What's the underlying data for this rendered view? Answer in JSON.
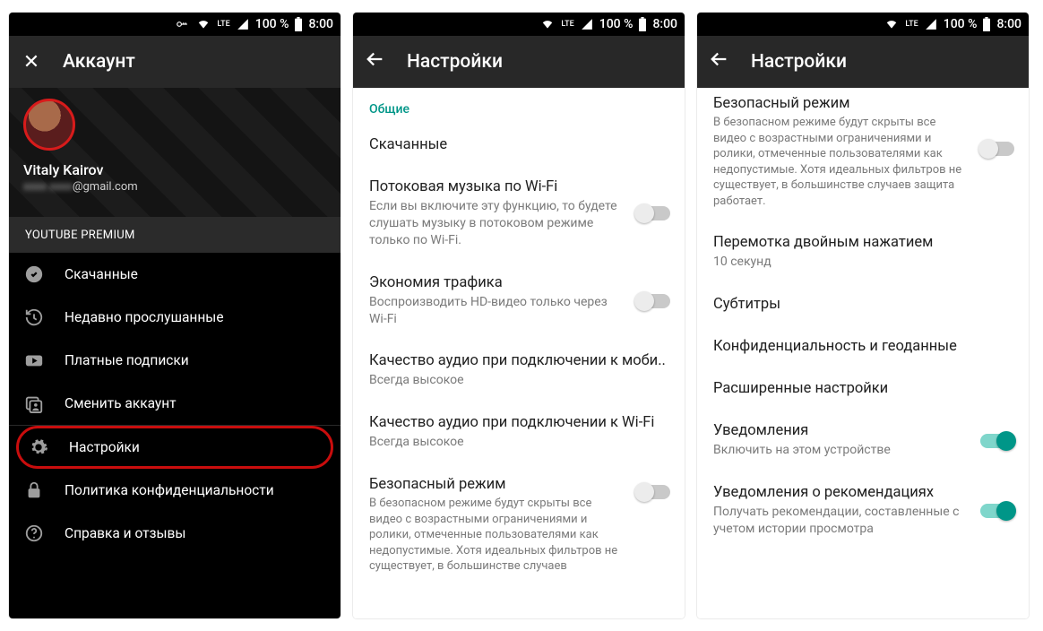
{
  "status": {
    "lte": "LTE",
    "battery": "100 %",
    "time": "8:00"
  },
  "screen1": {
    "title": "Аккаунт",
    "user_name": "Vitaly Kairov",
    "user_email_hidden": "xxxx xxxx",
    "user_email_domain": "@gmail.com",
    "premium": "YOUTUBE PREMIUM",
    "menu": {
      "downloads": "Скачанные",
      "recent": "Недавно прослушанные",
      "paid": "Платные подписки",
      "switch": "Сменить аккаунт",
      "settings": "Настройки",
      "privacy": "Политика конфиденциальности",
      "help": "Справка и отзывы"
    }
  },
  "screen2": {
    "title": "Настройки",
    "section_general": "Общие",
    "downloads": "Скачанные",
    "wifi_stream": {
      "title": "Потоковая музыка по Wi-Fi",
      "sub": "Если вы включите эту функцию, то будете слушать музыку в потоковом режиме только по Wi-Fi."
    },
    "data_saver": {
      "title": "Экономия трафика",
      "sub": "Воспроизводить HD-видео только через Wi-Fi"
    },
    "audio_mobile": {
      "title": "Качество аудио при подключении к моби..",
      "sub": "Всегда высокое"
    },
    "audio_wifi": {
      "title": "Качество аудио при подключении к Wi-Fi",
      "sub": "Всегда высокое"
    },
    "safe_mode": {
      "title": "Безопасный режим",
      "sub": "В безопасном режиме будут скрыты все видео с возрастными ограничениями и ролики, отмеченные пользователями как недопустимые. Хотя идеальных фильтров не существует, в большинстве случаев"
    }
  },
  "screen3": {
    "title": "Настройки",
    "safe_mode": {
      "title": "Безопасный режим",
      "sub": "В безопасном режиме будут скрыты все видео с возрастными ограничениями и ролики, отмеченные пользователями как недопустимые. Хотя идеальных фильтров не существует, в большинстве случаев защита работает."
    },
    "double_tap": {
      "title": "Перемотка двойным нажатием",
      "sub": "10 секунд"
    },
    "subtitles": "Субтитры",
    "privacy_geo": "Конфиденциальность и геоданные",
    "advanced": "Расширенные настройки",
    "notifications": {
      "title": "Уведомления",
      "sub": "Включить на этом устройстве"
    },
    "rec_notifications": {
      "title": "Уведомления о рекомендациях",
      "sub": "Получать рекомендации, составленные с учетом истории просмотра"
    }
  }
}
